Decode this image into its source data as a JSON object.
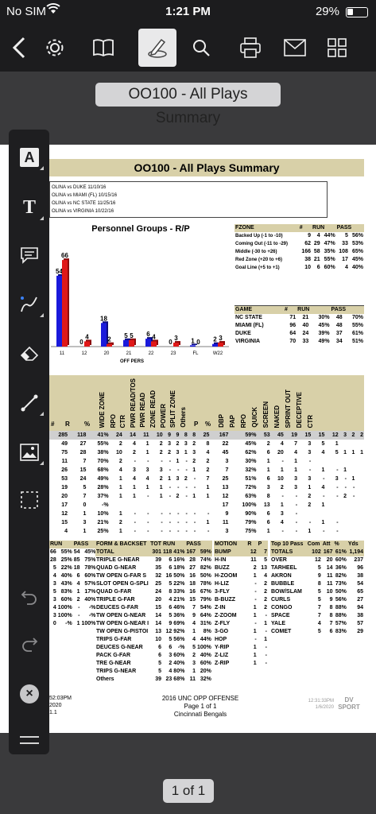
{
  "status": {
    "carrier": "No SIM",
    "time": "1:21 PM",
    "battery": "29%"
  },
  "toolbar": {
    "back": "back-icon",
    "settings": "gear-icon",
    "book": "book-icon",
    "annotate": "pen-icon",
    "search": "search-icon",
    "print": "printer-icon",
    "mail": "mail-icon",
    "grid": "grid-icon"
  },
  "document": {
    "title": "OO100 - All Plays Summary"
  },
  "pager": {
    "label": "1 of 1"
  },
  "report": {
    "header": "OO100 - All Plays Summary",
    "games": [
      "OLINA vs DUKE 11/10/16",
      "OLINA vs MIAMI (FL) 10/15/16",
      "OLINA vs NC STATE 11/25/16",
      "OLINA vs VIRGINIA 10/22/16"
    ],
    "chart_title": "Personnel Groups - R/P",
    "chart_xlabel": "OFF PERS",
    "fzone": {
      "head": [
        "FZONE",
        "#",
        "RUN",
        "PASS"
      ],
      "rows": [
        [
          "Backed Up (-1 to -10)",
          "9",
          "4",
          "44%",
          "5",
          "56%"
        ],
        [
          "Coming Out (-11 to -29)",
          "62",
          "29",
          "47%",
          "33",
          "53%"
        ],
        [
          "Middle (-30 to +26)",
          "166",
          "58",
          "35%",
          "108",
          "65%"
        ],
        [
          "Red Zone (+20 to +6)",
          "38",
          "21",
          "55%",
          "17",
          "45%"
        ],
        [
          "Goal Line (+5 to +1)",
          "10",
          "6",
          "60%",
          "4",
          "40%"
        ]
      ]
    },
    "game": {
      "head": [
        "GAME",
        "#",
        "RUN",
        "PASS"
      ],
      "rows": [
        [
          "NC STATE",
          "71",
          "21",
          "30%",
          "48",
          "70%"
        ],
        [
          "MIAMI (FL)",
          "96",
          "40",
          "45%",
          "48",
          "55%"
        ],
        [
          "DUKE",
          "64",
          "24",
          "39%",
          "37",
          "61%"
        ],
        [
          "VIRGINIA",
          "70",
          "33",
          "49%",
          "34",
          "51%"
        ]
      ]
    },
    "grid_cols": [
      "#",
      "R",
      "%",
      "WIDE ZONE",
      "RPO",
      "CTR",
      "PWR READ/TOS",
      "PWR READ",
      "ZONE READ",
      "POWER",
      "SPLIT ZONE",
      "Others",
      "P",
      "%",
      "DBP",
      "PAP",
      "RPO",
      "QUICK",
      "SCREEN",
      "NAKED",
      "SPRINT OUT",
      "DECEPTIVE",
      "CTR"
    ],
    "grid_rows": [
      [
        "285",
        "118",
        "41%",
        "24",
        "14",
        "11",
        "10",
        "9",
        "9",
        "8",
        "8",
        "25",
        "167",
        "59%",
        "53",
        "45",
        "19",
        "15",
        "15",
        "12",
        "3",
        "2",
        "2"
      ],
      [
        "49",
        "27",
        "55%",
        "2",
        "4",
        "1",
        "2",
        "3",
        "2",
        "3",
        "2",
        "8",
        "22",
        "45%",
        "2",
        "4",
        "7",
        "3",
        "5",
        "1",
        "",
        "",
        ""
      ],
      [
        "75",
        "28",
        "38%",
        "10",
        "2",
        "1",
        "2",
        "2",
        "3",
        "1",
        "3",
        "4",
        "45",
        "62%",
        "6",
        "20",
        "4",
        "3",
        "4",
        "5",
        "1",
        "1",
        "1"
      ],
      [
        "11",
        "7",
        "70%",
        "2",
        "-",
        "-",
        "-",
        "-",
        "1",
        "-",
        "2",
        "2",
        "3",
        "30%",
        "1",
        "-",
        "1",
        "-",
        "",
        "",
        "",
        "",
        ""
      ],
      [
        "26",
        "15",
        "68%",
        "4",
        "3",
        "3",
        "3",
        "-",
        "-",
        "-",
        "1",
        "2",
        "7",
        "32%",
        "1",
        "1",
        "1",
        "-",
        "1",
        "-",
        "1",
        "",
        ""
      ],
      [
        "53",
        "24",
        "49%",
        "1",
        "4",
        "4",
        "2",
        "1",
        "3",
        "2",
        "-",
        "7",
        "25",
        "51%",
        "6",
        "10",
        "3",
        "3",
        "-",
        "3",
        "-",
        "1",
        ""
      ],
      [
        "19",
        "5",
        "28%",
        "1",
        "1",
        "1",
        "1",
        "-",
        "-",
        "-",
        "-",
        "1",
        "13",
        "72%",
        "3",
        "2",
        "3",
        "1",
        "4",
        "-",
        "-",
        "-",
        ""
      ],
      [
        "20",
        "7",
        "37%",
        "1",
        "1",
        "-",
        "1",
        "-",
        "2",
        "-",
        "1",
        "1",
        "12",
        "63%",
        "8",
        "-",
        "-",
        "2",
        "-",
        "-",
        "2",
        "-",
        ""
      ],
      [
        "17",
        "0",
        "-%",
        "",
        "",
        "",
        "",
        "",
        "",
        "",
        "",
        "",
        "17",
        "100%",
        "13",
        "1",
        "-",
        "2",
        "1",
        "",
        "",
        "",
        ""
      ],
      [
        "12",
        "1",
        "10%",
        "1",
        "-",
        "-",
        "-",
        "-",
        "-",
        "-",
        "-",
        "-",
        "9",
        "90%",
        "6",
        "3",
        "-",
        "",
        "",
        "",
        "",
        "",
        ""
      ],
      [
        "15",
        "3",
        "21%",
        "2",
        "-",
        "-",
        "-",
        "-",
        "-",
        "-",
        "-",
        "1",
        "11",
        "79%",
        "6",
        "4",
        "-",
        "-",
        "1",
        "-",
        "",
        "",
        ""
      ],
      [
        "4",
        "1",
        "25%",
        "1",
        "-",
        "-",
        "-",
        "-",
        "-",
        "-",
        "-",
        "-",
        "3",
        "75%",
        "1",
        "-",
        "-",
        "1",
        "-",
        "-",
        "",
        "",
        ""
      ]
    ],
    "runpass": {
      "head": [
        "RUN",
        "PASS"
      ],
      "rows": [
        [
          "66",
          "55%",
          "54",
          "45%"
        ],
        [
          "28",
          "25%",
          "85",
          "75%"
        ],
        [
          "5",
          "22%",
          "18",
          "78%"
        ],
        [
          "4",
          "40%",
          "6",
          "60%"
        ],
        [
          "3",
          "43%",
          "4",
          "57%"
        ],
        [
          "5",
          "83%",
          "1",
          "17%"
        ],
        [
          "3",
          "60%",
          "2",
          "40%"
        ],
        [
          "4",
          "100%",
          "-",
          "-%"
        ],
        [
          "3",
          "100%",
          "-",
          "-%"
        ],
        [
          "0",
          "-%",
          "1",
          "100%"
        ]
      ]
    },
    "formation": {
      "head": [
        "FORM & BACKSET",
        "TOT",
        "RUN",
        "PASS"
      ],
      "rows": [
        [
          "TOTAL",
          "301",
          "118",
          "41%",
          "167",
          "59%"
        ],
        [
          "TRIPLE G-NEAR",
          "39",
          "6",
          "16%",
          "28",
          "74%"
        ],
        [
          "QUAD G-NEAR",
          "35",
          "6",
          "18%",
          "27",
          "82%"
        ],
        [
          "TW OPEN G-FAR S",
          "32",
          "16",
          "50%",
          "16",
          "50%"
        ],
        [
          "SLOT OPEN G-SPLI",
          "25",
          "5",
          "22%",
          "18",
          "78%"
        ],
        [
          "QUAD G-FAR",
          "24",
          "8",
          "33%",
          "16",
          "67%"
        ],
        [
          "TRIPLE G-FAR",
          "20",
          "4",
          "21%",
          "15",
          "79%"
        ],
        [
          "DEUCES G-FAR",
          "15",
          "6",
          "46%",
          "7",
          "54%"
        ],
        [
          "TW OPEN G-NEAR",
          "14",
          "5",
          "36%",
          "9",
          "64%"
        ],
        [
          "TW OPEN G-NEAR I",
          "14",
          "9",
          "69%",
          "4",
          "31%"
        ],
        [
          "TW OPEN G-PISTOI",
          "13",
          "12",
          "92%",
          "1",
          "8%"
        ],
        [
          "TRIPS G-FAR",
          "10",
          "5",
          "56%",
          "4",
          "44%"
        ],
        [
          "DEUCES G-NEAR",
          "6",
          "6",
          "-%",
          "5",
          "100%"
        ],
        [
          "PACK G-FAR",
          "6",
          "3",
          "60%",
          "2",
          "40%"
        ],
        [
          "TRE G-NEAR",
          "5",
          "2",
          "40%",
          "3",
          "60%"
        ],
        [
          "TRIPS G-NEAR",
          "5",
          "4",
          "80%",
          "1",
          "20%"
        ],
        [
          "Others",
          "39",
          "23",
          "68%",
          "11",
          "32%"
        ]
      ]
    },
    "motion": {
      "head": [
        "MOTION",
        "R",
        "P"
      ],
      "rows": [
        [
          "BUMP",
          "12",
          "7"
        ],
        [
          "H-IN",
          "11",
          "5"
        ],
        [
          "BUZZ",
          "2",
          "13"
        ],
        [
          "H-ZOOM",
          "1",
          "4"
        ],
        [
          "H-LIZ",
          "-",
          "2"
        ],
        [
          "3-FLY",
          "-",
          "2"
        ],
        [
          "B-BUZZ",
          "-",
          "2"
        ],
        [
          "Z-IN",
          "1",
          "2"
        ],
        [
          "Z-ZOOM",
          "1",
          "-"
        ],
        [
          "Z-FLY",
          "-",
          "1"
        ],
        [
          "3-GO",
          "1",
          "-"
        ],
        [
          "HOP",
          "-",
          "1"
        ],
        [
          "Y-RIP",
          "1",
          "-"
        ],
        [
          "Z-LIZ",
          "1",
          "-"
        ],
        [
          "Z-RIP",
          "1",
          "-"
        ]
      ]
    },
    "top10": {
      "head": [
        "Top 10 Pass",
        "Com",
        "Att",
        "%",
        "Yds"
      ],
      "rows": [
        [
          "TOTALS",
          "102",
          "167",
          "61%",
          "1,194"
        ],
        [
          "OVER",
          "12",
          "20",
          "60%",
          "237"
        ],
        [
          "TARHEEL",
          "5",
          "14",
          "36%",
          "96"
        ],
        [
          "AKRON",
          "9",
          "11",
          "82%",
          "38"
        ],
        [
          "BUBBLE",
          "8",
          "11",
          "73%",
          "54"
        ],
        [
          "BOW/SLAM",
          "5",
          "10",
          "50%",
          "65"
        ],
        [
          "CURLS",
          "5",
          "9",
          "56%",
          "27"
        ],
        [
          "CONGO",
          "7",
          "8",
          "88%",
          "94"
        ],
        [
          "SPACE",
          "7",
          "8",
          "88%",
          "38"
        ],
        [
          "YALE",
          "4",
          "7",
          "57%",
          "57"
        ],
        [
          "COMET",
          "5",
          "6",
          "83%",
          "29"
        ]
      ]
    },
    "footer": {
      "left": [
        "52:03PM",
        "2020",
        "1.1"
      ],
      "center": [
        "2016 UNC OPP OFFENSE",
        "Page 1 of 1",
        "Cincinnati Bengals"
      ],
      "right": [
        "12:31:33PM",
        "1/6/2020"
      ],
      "brand": "DV SPORT"
    }
  },
  "chart_data": {
    "type": "bar",
    "title": "Personnel Groups - R/P",
    "xlabel": "OFF PERS",
    "categories": [
      "11",
      "12",
      "20",
      "21",
      "22",
      "23",
      "FL",
      "W22"
    ],
    "series": [
      {
        "color": "#1a1adb",
        "values": [
          54,
          0,
          18,
          5,
          6,
          0,
          1,
          2
        ]
      },
      {
        "color": "#e01818",
        "values": [
          66,
          4,
          2,
          5,
          4,
          3,
          0,
          3
        ]
      }
    ],
    "ylim": [
      0,
      80
    ]
  },
  "colors": {
    "accent": "#d8d0a8",
    "run": "#1a1adb",
    "pass": "#e01818"
  },
  "tools": [
    "text-tool-icon",
    "typewriter-icon",
    "comment-icon",
    "pen-icon",
    "eraser-icon",
    "line-icon",
    "image-icon",
    "selection-icon",
    "undo-icon",
    "redo-icon",
    "close-icon",
    "menu-icon"
  ]
}
